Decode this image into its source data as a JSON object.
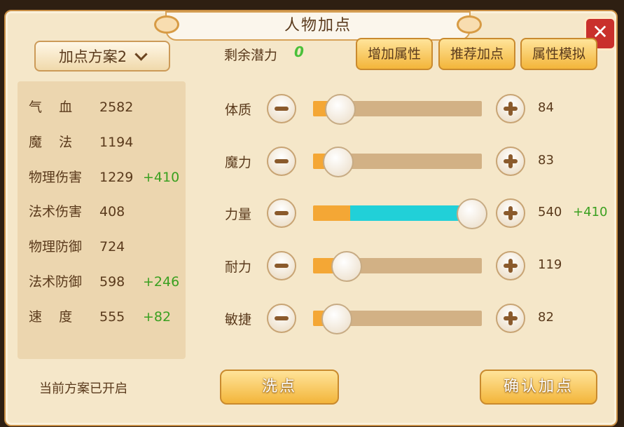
{
  "window": {
    "title": "人物加点"
  },
  "plan_select": {
    "label": "加点方案2"
  },
  "stats": [
    {
      "name": "气    血",
      "value": "2582",
      "bonus": ""
    },
    {
      "name": "魔    法",
      "value": "1194",
      "bonus": ""
    },
    {
      "name": "物理伤害",
      "value": "1229",
      "bonus": "+410"
    },
    {
      "name": "法术伤害",
      "value": "408",
      "bonus": ""
    },
    {
      "name": "物理防御",
      "value": "724",
      "bonus": ""
    },
    {
      "name": "法术防御",
      "value": "598",
      "bonus": "+246"
    },
    {
      "name": "速    度",
      "value": "555",
      "bonus": "+82"
    }
  ],
  "plan_status": "当前方案已开启",
  "potential": {
    "label": "剩余潜力",
    "value": "0"
  },
  "top_buttons": {
    "add": "增加属性",
    "recommend": "推荐加点",
    "simulate": "属性模拟"
  },
  "attributes": [
    {
      "name": "体质",
      "value": "84",
      "bonus": "",
      "base_fill": 0.16,
      "extra_fill": 0
    },
    {
      "name": "魔力",
      "value": "83",
      "bonus": "",
      "base_fill": 0.15,
      "extra_fill": 0
    },
    {
      "name": "力量",
      "value": "540",
      "bonus": "+410",
      "base_fill": 0.22,
      "extra_fill": 0.72
    },
    {
      "name": "耐力",
      "value": "119",
      "bonus": "",
      "base_fill": 0.2,
      "extra_fill": 0
    },
    {
      "name": "敏捷",
      "value": "82",
      "bonus": "",
      "base_fill": 0.14,
      "extra_fill": 0
    }
  ],
  "bottom_buttons": {
    "reset": "洗点",
    "confirm": "确认加点"
  },
  "colors": {
    "frame": "#c98f45",
    "panel": "#f5e7c9",
    "bonus": "#3aa020",
    "extra_fill": "#21d0d8",
    "base_fill": "#f4a735"
  },
  "icons": {
    "close": "close-x-icon",
    "dropdown": "chevron-down-icon",
    "minus": "minus-icon",
    "plus": "plus-icon"
  }
}
